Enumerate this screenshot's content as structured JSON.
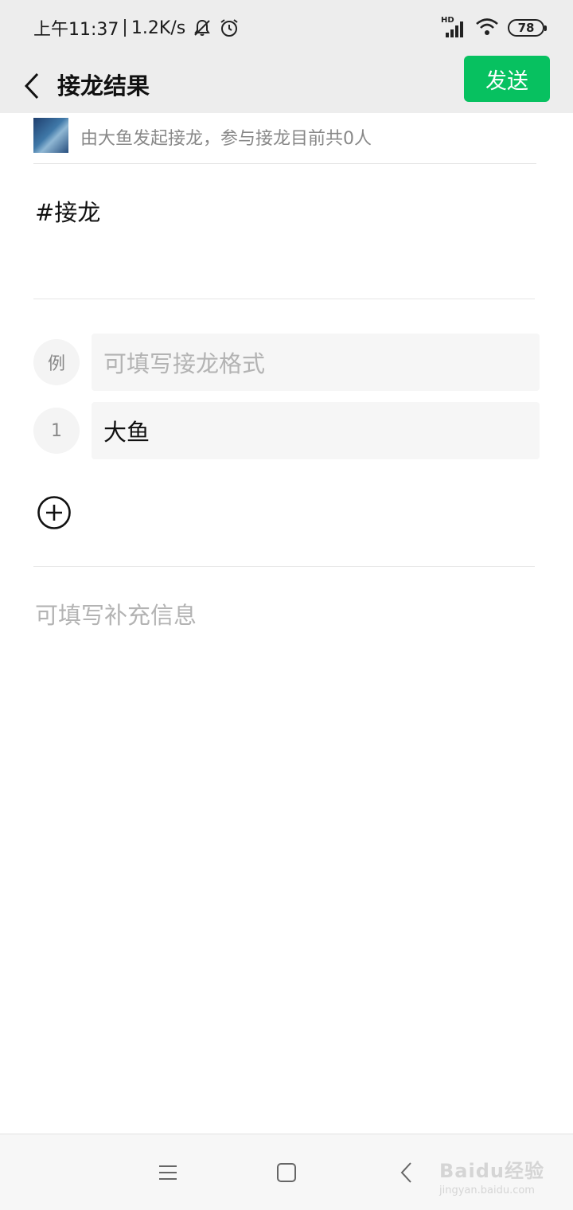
{
  "status_bar": {
    "time": "上午11:37",
    "speed": "1.2K/s",
    "network": "HD",
    "battery": "78"
  },
  "nav": {
    "title": "接龙结果",
    "send_label": "发送"
  },
  "info": {
    "text": "由大鱼发起接龙，参与接龙目前共0人"
  },
  "topic": "#接龙",
  "entries": [
    {
      "badge": "例",
      "placeholder": "可填写接龙格式",
      "value": ""
    },
    {
      "badge": "1",
      "placeholder": "",
      "value": "大鱼"
    }
  ],
  "extra_info_placeholder": "可填写补充信息",
  "watermark": {
    "main": "Baidu经验",
    "sub": "jingyan.baidu.com"
  },
  "colors": {
    "accent": "#07c160",
    "bar_background": "#ededed",
    "placeholder": "#b3b3b3"
  }
}
